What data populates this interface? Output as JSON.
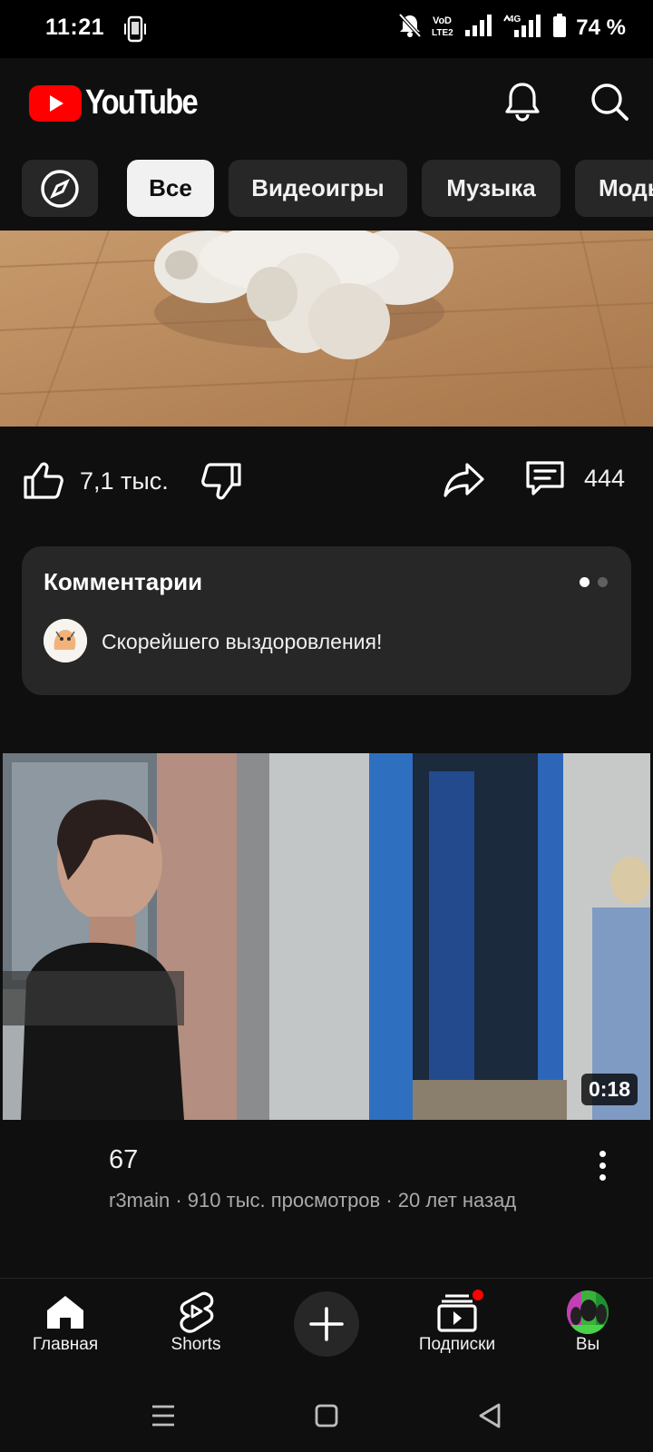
{
  "status_bar": {
    "time": "11:21",
    "battery": "74 %",
    "network": "4G",
    "volte": "VoLTE2",
    "icons": [
      "vibrate-icon",
      "mute-icon",
      "signal-icon",
      "battery-icon"
    ]
  },
  "header": {
    "logo_text": "YouTube",
    "brand_color": "#ff0000",
    "icons": [
      "notifications-icon",
      "search-icon"
    ]
  },
  "chips": [
    {
      "label": "Все",
      "active": true
    },
    {
      "label": "Видеоигры",
      "active": false
    },
    {
      "label": "Музыка",
      "active": false
    },
    {
      "label": "Моды",
      "active": false
    }
  ],
  "actions": {
    "likes": "7,1 тыс.",
    "comments_count": "444"
  },
  "comments_card": {
    "title": "Комментарии",
    "top_comment": "Скорейшего выздоровления!"
  },
  "video": {
    "duration": "0:18",
    "title": "67",
    "meta": "r3main · 910 тыс. просмотров · 20 лет назад"
  },
  "bottom_nav": {
    "home": "Главная",
    "shorts": "Shorts",
    "subscriptions": "Подписки",
    "you": "Вы"
  }
}
